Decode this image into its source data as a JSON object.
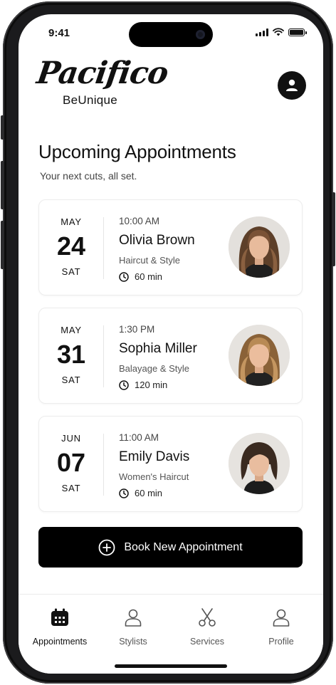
{
  "status_bar": {
    "time": "9:41"
  },
  "brand": {
    "name": "Pacifico",
    "tagline": "BeUnique"
  },
  "header": {
    "title": "Upcoming Appointments",
    "subtitle": "Your next cuts, all set."
  },
  "appointments": [
    {
      "month": "MAY",
      "day": "24",
      "weekday": "SAT",
      "time": "10:00 AM",
      "client": "Olivia Brown",
      "service": "Haircut & Style",
      "duration": "60 min"
    },
    {
      "month": "MAY",
      "day": "31",
      "weekday": "SAT",
      "time": "1:30 PM",
      "client": "Sophia Miller",
      "service": "Balayage & Style",
      "duration": "120 min"
    },
    {
      "month": "JUN",
      "day": "07",
      "weekday": "SAT",
      "time": "11:00 AM",
      "client": "Emily Davis",
      "service": "Women's Haircut",
      "duration": "60 min"
    }
  ],
  "book_button": {
    "label": "Book New Appointment"
  },
  "tabs": [
    {
      "label": "Appointments",
      "icon": "calendar-icon",
      "active": true
    },
    {
      "label": "Stylists",
      "icon": "person-icon",
      "active": false
    },
    {
      "label": "Services",
      "icon": "scissors-icon",
      "active": false
    },
    {
      "label": "Profile",
      "icon": "person-icon",
      "active": false
    }
  ],
  "colors": {
    "accent": "#000000",
    "background": "#ffffff",
    "card_border": "#ececec"
  }
}
